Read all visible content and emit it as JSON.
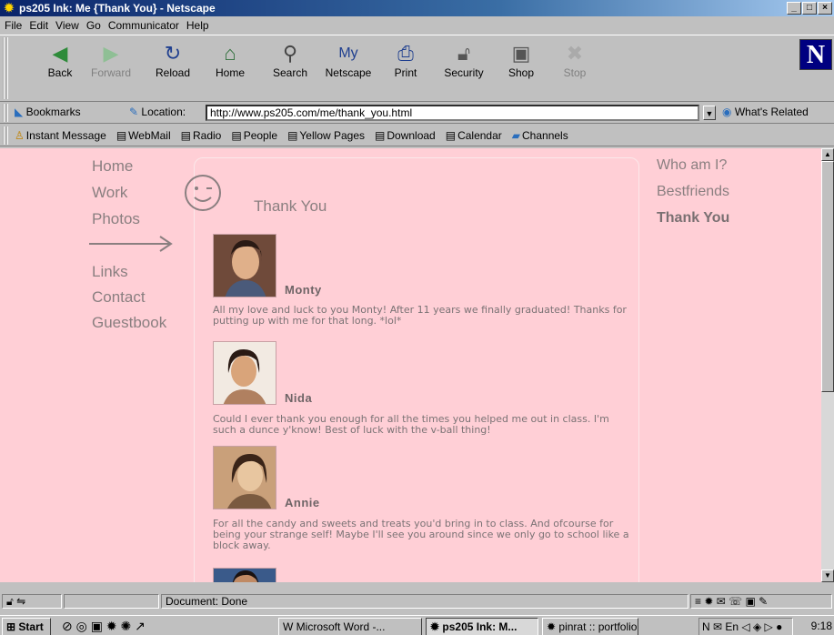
{
  "window": {
    "title": "ps205 Ink: Me {Thank You} - Netscape"
  },
  "menu": [
    "File",
    "Edit",
    "View",
    "Go",
    "Communicator",
    "Help"
  ],
  "navbar": {
    "back": "Back",
    "forward": "Forward",
    "reload": "Reload",
    "home": "Home",
    "search": "Search",
    "netscape": "Netscape",
    "print": "Print",
    "security": "Security",
    "shop": "Shop",
    "stop": "Stop"
  },
  "location": {
    "bookmarks": "Bookmarks",
    "label": "Location:",
    "url": "http://www.ps205.com/me/thank_you.html",
    "whats_related": "What's Related"
  },
  "personal_toolbar": [
    "Instant Message",
    "WebMail",
    "Radio",
    "People",
    "Yellow Pages",
    "Download",
    "Calendar",
    "Channels"
  ],
  "page": {
    "left_nav": [
      "Home",
      "Work",
      "Photos"
    ],
    "left_nav2": [
      "Links",
      "Contact",
      "Guestbook"
    ],
    "title": "Thank You",
    "right_nav": [
      "Who am I?",
      "Bestfriends",
      "Thank You"
    ],
    "people": [
      {
        "name": "Monty",
        "message": "All my love and luck to you Monty! After 11 years we finally graduated! Thanks for putting up with me for that long. *lol*"
      },
      {
        "name": "Nida",
        "message": "Could I ever thank you enough for all the times you helped me out in class. I'm such a dunce y'know! Best of luck with the v-ball thing!"
      },
      {
        "name": "Annie",
        "message": "For all the candy and sweets and treats you'd bring in to class. And ofcourse for being your strange self! Maybe I'll see you around since we only go to school like a block away."
      }
    ]
  },
  "status": {
    "text": "Document: Done"
  },
  "taskbar": {
    "start": "Start",
    "items": [
      "Microsoft Word -...",
      "ps205 Ink: M...",
      "pinrat :: portfolio ..."
    ],
    "clock": "9:18 AM"
  }
}
